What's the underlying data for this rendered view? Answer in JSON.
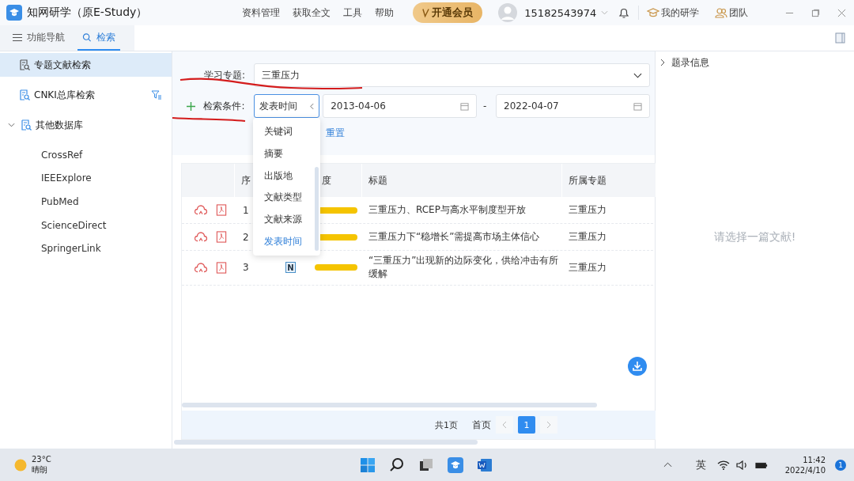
{
  "window": {
    "title": "知网研学（原E-Study）",
    "menu": [
      "资料管理",
      "获取全文",
      "工具",
      "帮助"
    ],
    "vip_button": "开通会员",
    "account": "15182543974",
    "links": [
      "我的研学",
      "团队"
    ]
  },
  "nav_tabs": [
    {
      "label": "功能导航",
      "selected": false
    },
    {
      "label": "检索",
      "selected": true
    }
  ],
  "sidebar": {
    "items": [
      {
        "label": "专题文献检索",
        "selected": true,
        "kind": "search"
      },
      {
        "label": "CNKI总库检索",
        "selected": false,
        "kind": "filter"
      },
      {
        "label": "其他数据库",
        "selected": false,
        "kind": "group",
        "expanded": true,
        "children": [
          {
            "label": "CrossRef"
          },
          {
            "label": "IEEExplore"
          },
          {
            "label": "PubMed"
          },
          {
            "label": "ScienceDirect"
          },
          {
            "label": "SpringerLink"
          }
        ]
      }
    ]
  },
  "form": {
    "topic_label": "学习专题:",
    "topic_value": "三重压力",
    "condition_label": "检索条件:",
    "condition_value": "发表时间",
    "date_from": "2013-04-06",
    "date_separator": "-",
    "date_to": "2022-04-07",
    "reset": "重置",
    "dropdown": [
      {
        "label": "关键词",
        "selected": false
      },
      {
        "label": "摘要",
        "selected": false
      },
      {
        "label": "出版地",
        "selected": false
      },
      {
        "label": "文献类型",
        "selected": false
      },
      {
        "label": "文献来源",
        "selected": false
      },
      {
        "label": "发表时间",
        "selected": true
      }
    ]
  },
  "table": {
    "columns": [
      "序",
      "度",
      "标题",
      "所属专题"
    ],
    "rows": [
      {
        "number": "1",
        "level": 1,
        "title": "三重压力、RCEP与高水平制度型开放",
        "topic": "三重压力"
      },
      {
        "number": "2",
        "level": 1,
        "title": "三重压力下“稳增长”需提高市场主体信心",
        "topic": "三重压力"
      },
      {
        "number": "3",
        "type_badge": "N",
        "level": 1,
        "title": "“三重压力”出现新的边际变化，供给冲击有所缓解",
        "topic": "三重压力"
      }
    ]
  },
  "pagination": {
    "total": "共1页",
    "first": "首页",
    "pages": [
      {
        "label": "1",
        "selected": true
      }
    ]
  },
  "detail_panel": {
    "title": "题录信息",
    "empty_message": "请选择一篇文献!"
  },
  "taskbar": {
    "temperature": "23°C",
    "weather": "晴朗",
    "ime": "英",
    "time": "11:42",
    "date": "2022/4/10",
    "notifications": "1"
  }
}
